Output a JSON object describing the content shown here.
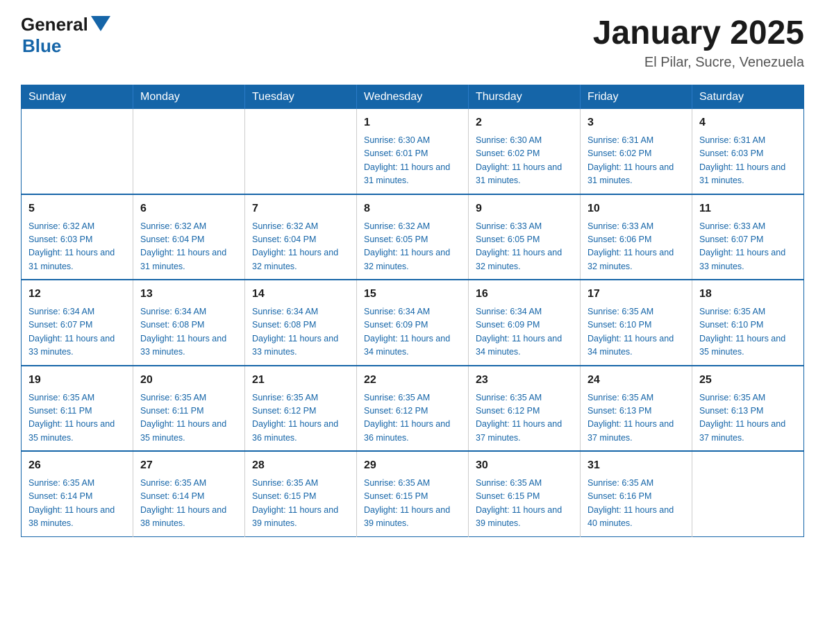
{
  "logo": {
    "general": "General",
    "blue": "Blue",
    "tagline": "Blue"
  },
  "header": {
    "month": "January 2025",
    "location": "El Pilar, Sucre, Venezuela"
  },
  "days_of_week": [
    "Sunday",
    "Monday",
    "Tuesday",
    "Wednesday",
    "Thursday",
    "Friday",
    "Saturday"
  ],
  "weeks": [
    {
      "days": [
        {
          "number": "",
          "info": ""
        },
        {
          "number": "",
          "info": ""
        },
        {
          "number": "",
          "info": ""
        },
        {
          "number": "1",
          "info": "Sunrise: 6:30 AM\nSunset: 6:01 PM\nDaylight: 11 hours and 31 minutes."
        },
        {
          "number": "2",
          "info": "Sunrise: 6:30 AM\nSunset: 6:02 PM\nDaylight: 11 hours and 31 minutes."
        },
        {
          "number": "3",
          "info": "Sunrise: 6:31 AM\nSunset: 6:02 PM\nDaylight: 11 hours and 31 minutes."
        },
        {
          "number": "4",
          "info": "Sunrise: 6:31 AM\nSunset: 6:03 PM\nDaylight: 11 hours and 31 minutes."
        }
      ]
    },
    {
      "days": [
        {
          "number": "5",
          "info": "Sunrise: 6:32 AM\nSunset: 6:03 PM\nDaylight: 11 hours and 31 minutes."
        },
        {
          "number": "6",
          "info": "Sunrise: 6:32 AM\nSunset: 6:04 PM\nDaylight: 11 hours and 31 minutes."
        },
        {
          "number": "7",
          "info": "Sunrise: 6:32 AM\nSunset: 6:04 PM\nDaylight: 11 hours and 32 minutes."
        },
        {
          "number": "8",
          "info": "Sunrise: 6:32 AM\nSunset: 6:05 PM\nDaylight: 11 hours and 32 minutes."
        },
        {
          "number": "9",
          "info": "Sunrise: 6:33 AM\nSunset: 6:05 PM\nDaylight: 11 hours and 32 minutes."
        },
        {
          "number": "10",
          "info": "Sunrise: 6:33 AM\nSunset: 6:06 PM\nDaylight: 11 hours and 32 minutes."
        },
        {
          "number": "11",
          "info": "Sunrise: 6:33 AM\nSunset: 6:07 PM\nDaylight: 11 hours and 33 minutes."
        }
      ]
    },
    {
      "days": [
        {
          "number": "12",
          "info": "Sunrise: 6:34 AM\nSunset: 6:07 PM\nDaylight: 11 hours and 33 minutes."
        },
        {
          "number": "13",
          "info": "Sunrise: 6:34 AM\nSunset: 6:08 PM\nDaylight: 11 hours and 33 minutes."
        },
        {
          "number": "14",
          "info": "Sunrise: 6:34 AM\nSunset: 6:08 PM\nDaylight: 11 hours and 33 minutes."
        },
        {
          "number": "15",
          "info": "Sunrise: 6:34 AM\nSunset: 6:09 PM\nDaylight: 11 hours and 34 minutes."
        },
        {
          "number": "16",
          "info": "Sunrise: 6:34 AM\nSunset: 6:09 PM\nDaylight: 11 hours and 34 minutes."
        },
        {
          "number": "17",
          "info": "Sunrise: 6:35 AM\nSunset: 6:10 PM\nDaylight: 11 hours and 34 minutes."
        },
        {
          "number": "18",
          "info": "Sunrise: 6:35 AM\nSunset: 6:10 PM\nDaylight: 11 hours and 35 minutes."
        }
      ]
    },
    {
      "days": [
        {
          "number": "19",
          "info": "Sunrise: 6:35 AM\nSunset: 6:11 PM\nDaylight: 11 hours and 35 minutes."
        },
        {
          "number": "20",
          "info": "Sunrise: 6:35 AM\nSunset: 6:11 PM\nDaylight: 11 hours and 35 minutes."
        },
        {
          "number": "21",
          "info": "Sunrise: 6:35 AM\nSunset: 6:12 PM\nDaylight: 11 hours and 36 minutes."
        },
        {
          "number": "22",
          "info": "Sunrise: 6:35 AM\nSunset: 6:12 PM\nDaylight: 11 hours and 36 minutes."
        },
        {
          "number": "23",
          "info": "Sunrise: 6:35 AM\nSunset: 6:12 PM\nDaylight: 11 hours and 37 minutes."
        },
        {
          "number": "24",
          "info": "Sunrise: 6:35 AM\nSunset: 6:13 PM\nDaylight: 11 hours and 37 minutes."
        },
        {
          "number": "25",
          "info": "Sunrise: 6:35 AM\nSunset: 6:13 PM\nDaylight: 11 hours and 37 minutes."
        }
      ]
    },
    {
      "days": [
        {
          "number": "26",
          "info": "Sunrise: 6:35 AM\nSunset: 6:14 PM\nDaylight: 11 hours and 38 minutes."
        },
        {
          "number": "27",
          "info": "Sunrise: 6:35 AM\nSunset: 6:14 PM\nDaylight: 11 hours and 38 minutes."
        },
        {
          "number": "28",
          "info": "Sunrise: 6:35 AM\nSunset: 6:15 PM\nDaylight: 11 hours and 39 minutes."
        },
        {
          "number": "29",
          "info": "Sunrise: 6:35 AM\nSunset: 6:15 PM\nDaylight: 11 hours and 39 minutes."
        },
        {
          "number": "30",
          "info": "Sunrise: 6:35 AM\nSunset: 6:15 PM\nDaylight: 11 hours and 39 minutes."
        },
        {
          "number": "31",
          "info": "Sunrise: 6:35 AM\nSunset: 6:16 PM\nDaylight: 11 hours and 40 minutes."
        },
        {
          "number": "",
          "info": ""
        }
      ]
    }
  ]
}
